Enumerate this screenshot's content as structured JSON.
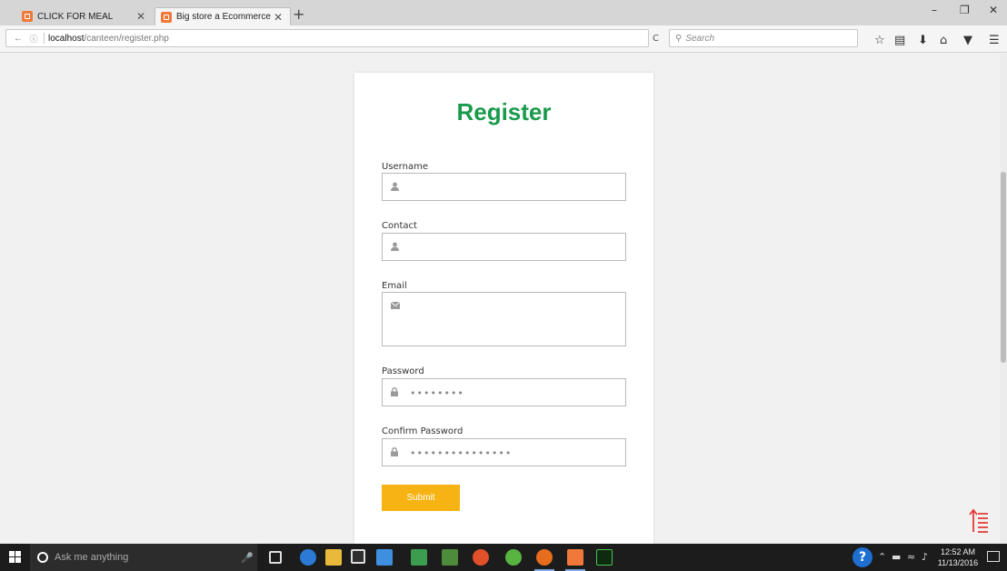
{
  "browser": {
    "tabs": [
      {
        "title": "CLICK FOR MEAL",
        "active": false
      },
      {
        "title": "Big store a Ecommerce O...",
        "active": true
      }
    ],
    "tab_close": "✕",
    "new_tab": "+",
    "window_controls": {
      "minimize": "–",
      "restore": "❐",
      "close": "✕"
    },
    "url": {
      "host": "localhost",
      "path": "/canteen/register.php"
    },
    "reload_icon": "C",
    "search_placeholder": "Search",
    "toolbar_icons": [
      "star-icon",
      "reading-list-icon",
      "download-icon",
      "home-icon",
      "pocket-icon",
      "menu-icon"
    ]
  },
  "form": {
    "title": "Register",
    "fields": [
      {
        "label": "Username",
        "icon": "user-icon",
        "value": ""
      },
      {
        "label": "Contact",
        "icon": "user-icon",
        "value": ""
      },
      {
        "label": "Email",
        "icon": "envelope-icon",
        "value": ""
      },
      {
        "label": "Password",
        "icon": "lock-icon",
        "value": "••••••••"
      },
      {
        "label": "Confirm Password",
        "icon": "lock-icon",
        "value": "•••••••••••••••"
      }
    ],
    "submit_label": "Submit"
  },
  "colors": {
    "title_green": "#1a9a4c",
    "submit_yellow": "#f6b313",
    "scroll_top_red": "#e53935"
  },
  "taskbar": {
    "search_placeholder": "Ask me anything",
    "clock_time": "12:52 AM",
    "clock_date": "11/13/2016",
    "help_glyph": "?",
    "apps": [
      "task-view-icon",
      "edge-icon",
      "file-explorer-icon",
      "store-icon",
      "dropbox-icon",
      "gallery-icon",
      "evernote-icon",
      "chrome-icon",
      "app-icon",
      "firefox-icon",
      "xampp-icon",
      "dreamweaver-icon"
    ]
  }
}
